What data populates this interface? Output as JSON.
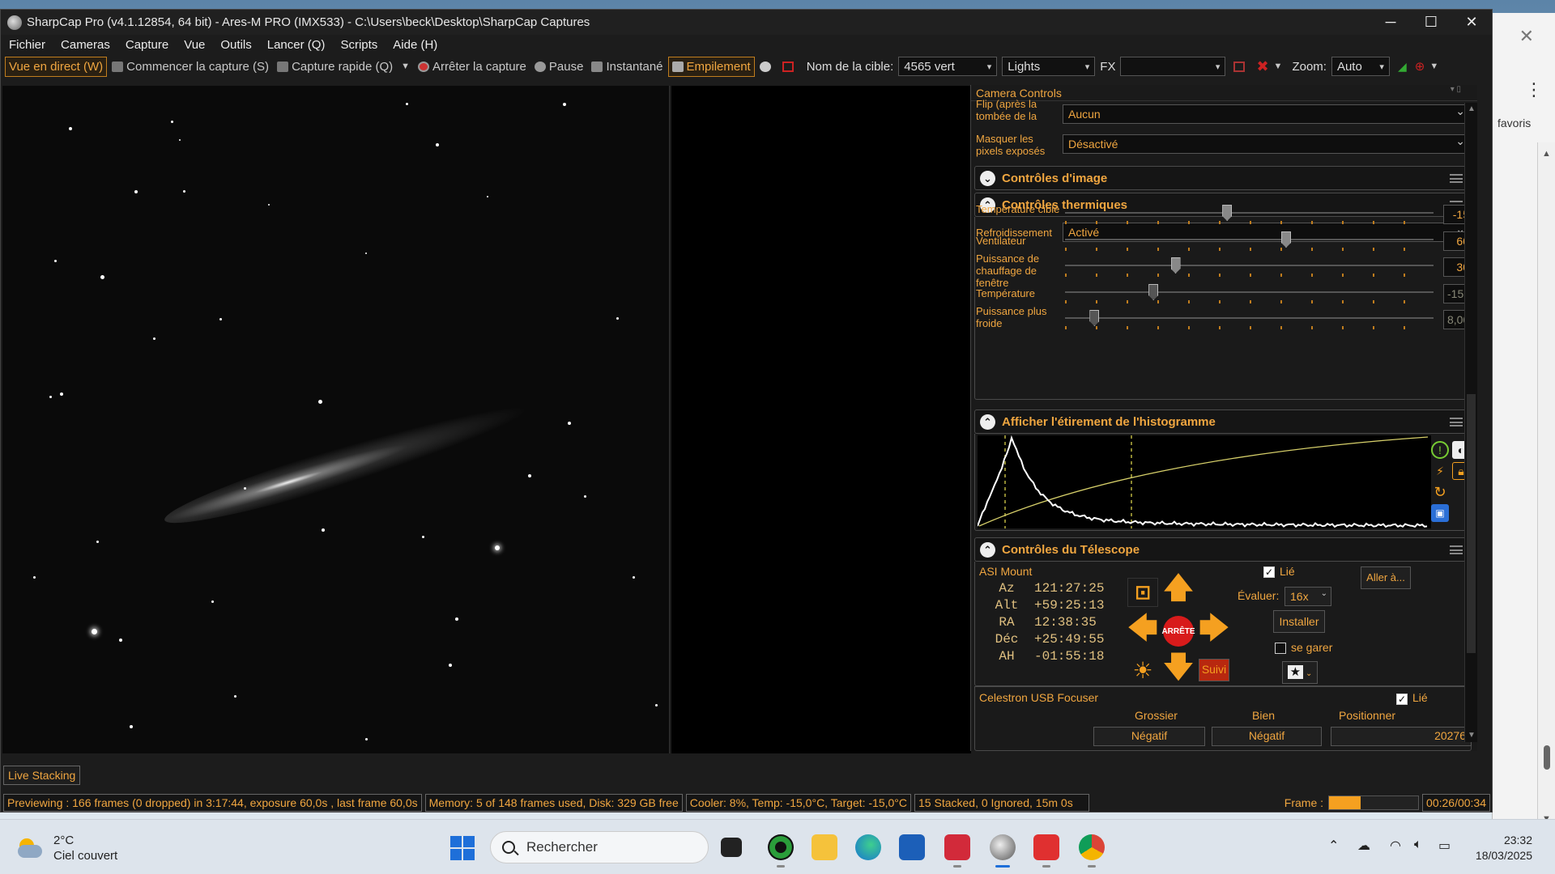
{
  "window": {
    "title": "SharpCap Pro (v4.1.12854, 64 bit) - Ares-M PRO (IMX533) - C:\\Users\\beck\\Desktop\\SharpCap Captures",
    "controls": {
      "minimize": "─",
      "maximize": "☐",
      "close": "✕"
    }
  },
  "menu": [
    "Fichier",
    "Cameras",
    "Capture",
    "Vue",
    "Outils",
    "Lancer (Q)",
    "Scripts",
    "Aide (H)"
  ],
  "toolbar": {
    "live_view": "Vue en direct (W)",
    "start_capture": "Commencer la capture (S)",
    "quick_capture": "Capture rapide (Q)",
    "stop_capture": "Arrêter la capture",
    "pause": "Pause",
    "snapshot": "Instantané",
    "stacking": "Empilement",
    "target_label": "Nom de la cible:",
    "target_value": "4565 vert",
    "frame_type": "Lights",
    "fx_label": "FX",
    "fx_value": "",
    "zoom_label": "Zoom:",
    "zoom_value": "Auto"
  },
  "live_stacking_tab": "Live Stacking",
  "panel": {
    "title": "Camera Controls",
    "flip_label": "Flip (après la tombée de la nuit/à plat)",
    "flip_value": "Aucun",
    "mask_label": "Masquer les pixels exposés",
    "mask_value": "Désactivé",
    "image_controls": "Contrôles d'image",
    "thermal_controls": "Contrôles thermiques",
    "cooling_label": "Refroidissement",
    "cooling_value": "Activé",
    "sliders": [
      {
        "label": "Température cible",
        "value": "-15",
        "level": 0.44
      },
      {
        "label": "Ventilateur",
        "value": "60",
        "level": 0.6
      },
      {
        "label": "Puissance de chauffage de fenêtre",
        "value": "30",
        "level": 0.3
      },
      {
        "label": "Température",
        "value": "-15,0",
        "level": 0.24
      },
      {
        "label": "Puissance plus froide",
        "value": "8,00",
        "level": 0.08
      }
    ],
    "histogram_title": "Afficher l'étirement de l'histogramme",
    "telescope_title": "Contrôles du Télescope",
    "mount_name": "ASI Mount",
    "linked_label": "Lié",
    "goto_button": "Aller à...",
    "coords": [
      {
        "k": "Az",
        "v": "121:27:25"
      },
      {
        "k": "Alt",
        "v": "+59:25:13"
      },
      {
        "k": "RA",
        "v": "12:38:35"
      },
      {
        "k": "Déc",
        "v": "+25:49:55"
      },
      {
        "k": "AH",
        "v": "-01:55:18"
      }
    ],
    "rate_label": "Évaluer:",
    "rate_value": "16x",
    "install_button": "Installer",
    "park_label": "se garer",
    "stop_label": "ARRÊTE",
    "track_button": "Suivi",
    "focuser_name": "Celestron USB Focuser",
    "focuser_linked": "Lié",
    "coarse_label": "Grossier",
    "fine_label": "Bien",
    "position_label": "Positionner",
    "coarse_button": "Négatif",
    "fine_button": "Négatif",
    "position_value": "20276"
  },
  "status": {
    "preview": "Previewing : 166 frames (0 dropped) in 3:17:44, exposure 60,0s , last frame 60,0s",
    "memory": "Memory: 5 of 148 frames used, Disk: 329 GB free",
    "cooler": "Cooler: 8%, Temp: -15,0°C, Target: -15,0°C",
    "stacked": "15 Stacked, 0 Ignored, 15m 0s",
    "frame_label": "Frame :",
    "frame_progress": 0.35,
    "time": "00:26/00:34"
  },
  "background_window": {
    "favorites": "favoris"
  },
  "taskbar": {
    "temp": "2°C",
    "weather": "Ciel couvert",
    "search": "Rechercher",
    "time": "23:32",
    "date": "18/03/2025"
  },
  "colors": {
    "accent": "#f0a640",
    "stop": "#d81b1b",
    "arrow": "#f5a020"
  }
}
